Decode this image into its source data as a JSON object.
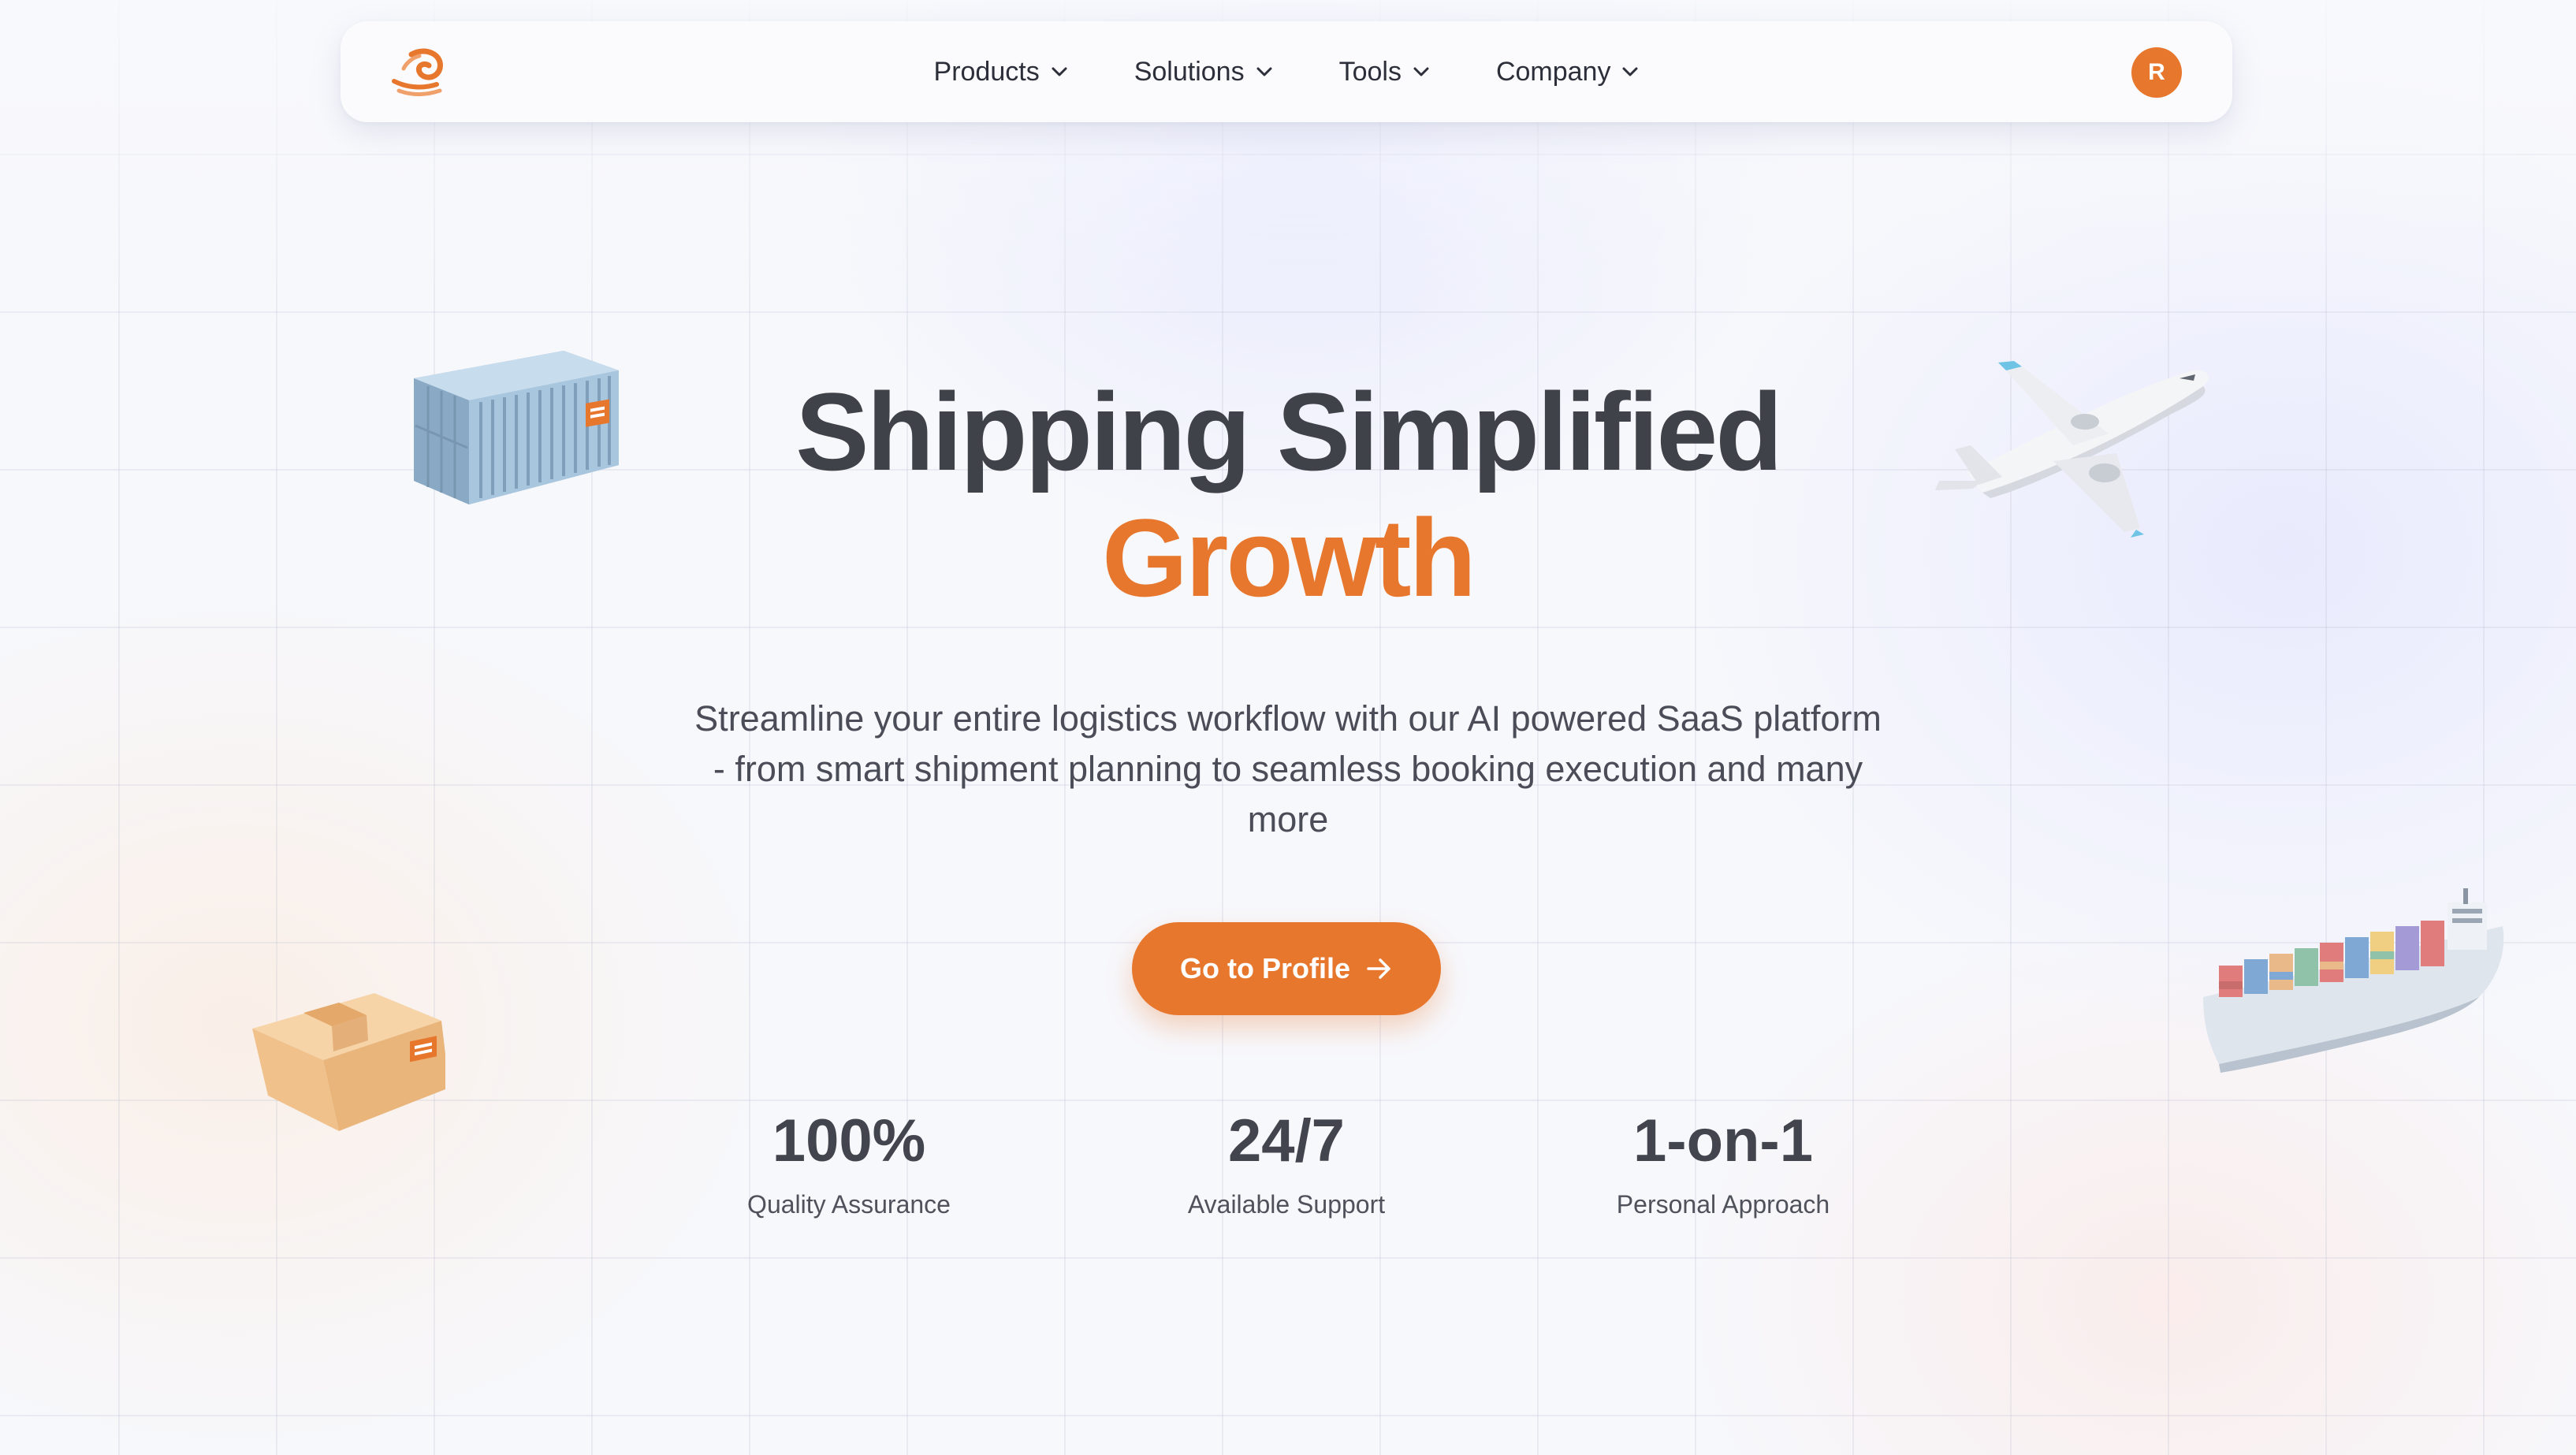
{
  "nav": {
    "logo_icon": "wave-swirl-logo",
    "items": [
      {
        "label": "Products",
        "icon": "chevron-down-icon"
      },
      {
        "label": "Solutions",
        "icon": "chevron-down-icon"
      },
      {
        "label": "Tools",
        "icon": "chevron-down-icon"
      },
      {
        "label": "Company",
        "icon": "chevron-down-icon"
      }
    ],
    "avatar_initial": "R"
  },
  "hero": {
    "title_line1": "Shipping Simplified",
    "title_line2": "Growth",
    "subtitle": "Streamline your entire logistics workflow with our AI powered SaaS platform - from smart shipment planning to seamless booking execution and many more",
    "cta_label": "Go to Profile",
    "cta_icon": "arrow-right-icon"
  },
  "stats": [
    {
      "value": "100%",
      "label": "Quality Assurance"
    },
    {
      "value": "24/7",
      "label": "Available Support"
    },
    {
      "value": "1-on-1",
      "label": "Personal Approach"
    }
  ],
  "illustrations": [
    "shipping-container",
    "airplane",
    "cardboard-box",
    "cargo-ship"
  ],
  "colors": {
    "accent": "#e8772e",
    "heading": "#3f4249",
    "text": "#4a4d57",
    "container": "#a9c6df",
    "box": "#f2c48e"
  }
}
